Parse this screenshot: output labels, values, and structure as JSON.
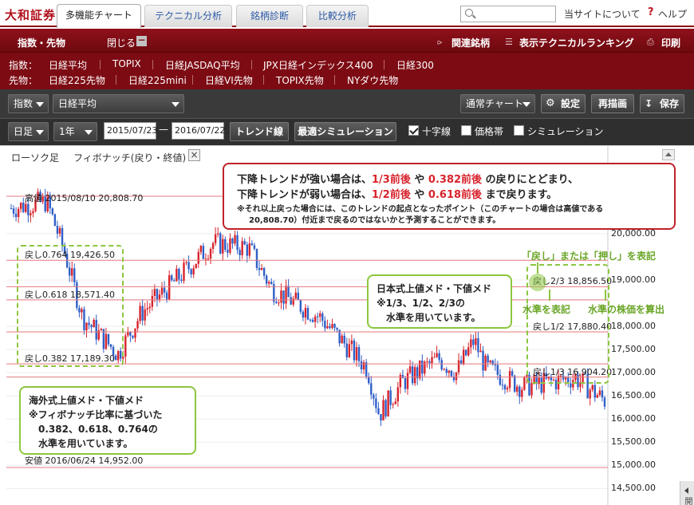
{
  "header": {
    "logo": "大和証券",
    "tabs": [
      {
        "label": "多機能チャート",
        "active": true
      },
      {
        "label": "テクニカル分析",
        "active": false
      },
      {
        "label": "銘柄診断",
        "active": false
      },
      {
        "label": "比較分析",
        "active": false
      }
    ],
    "search_placeholder": "",
    "about": "当サイトについて",
    "help_mark": "?",
    "help": "ヘルプ"
  },
  "panel": {
    "title": "指数・先物",
    "close": "閉じる",
    "close_mark": "−",
    "links": [
      "関連銘柄",
      "表示テクニカルランキング",
      "印刷"
    ],
    "row1_label": "指数：",
    "row1": [
      "日経平均",
      "TOPIX",
      "日経JASDAQ平均",
      "JPX日経インデックス400",
      "日経300"
    ],
    "row2_label": "先物：",
    "row2": [
      "日経225先物",
      "日経225mini",
      "日経VI先物",
      "TOPIX先物",
      "NYダウ先物"
    ]
  },
  "toolbar1": {
    "category": "指数",
    "symbol": "日経平均",
    "chart_type": "通常チャート",
    "settings": "設定",
    "redraw": "再描画",
    "save": "保存"
  },
  "toolbar2": {
    "period": "日足",
    "range": "1年",
    "date_from": "2015/07/23",
    "date_sep": "—",
    "date_to": "2016/07/22",
    "trendline": "トレンド線",
    "optimize": "最適シミュレーション",
    "crosshair": {
      "label": "十字線",
      "checked": true
    },
    "price_band": {
      "label": "価格帯",
      "checked": false
    },
    "simulation": {
      "label": "シミュレーション",
      "checked": false
    }
  },
  "chart": {
    "legend_candle": "ローソク足",
    "legend_fib": "フィボナッチ(戻り・終値)",
    "legend_close": "×",
    "side_tab": "開く",
    "high_label": "高値 2015/08/10 20,808.70",
    "low_label": "安値 2016/06/24 14,952.00",
    "fib_left": [
      {
        "label": "戻し0.764 19,426.50",
        "value": 19426.5
      },
      {
        "label": "戻し0.618 18,571.40",
        "value": 18571.4
      },
      {
        "label": "戻し0.382 17,189.30",
        "value": 17189.3
      }
    ],
    "fib_right": [
      {
        "label": "戻し2/3 18,856.50",
        "value": 18856.5
      },
      {
        "label": "戻し1/2 17,880.40",
        "value": 17880.4
      },
      {
        "label": "戻し1/3 16,904.20",
        "value": 16904.2
      }
    ],
    "y_ticks": [
      "20,000.00",
      "19,000.00",
      "18,000.00",
      "17,500.00",
      "17,000.00",
      "16,500.00",
      "16,000.00",
      "15,500.00",
      "15,000.00",
      "14,500.00"
    ],
    "colors": {
      "up": "#d8242d",
      "down": "#2f5fc8",
      "fib_line": "#e3787c",
      "callout_red": "#c0222b",
      "callout_green": "#8cc63f"
    }
  },
  "callouts": {
    "top_line1_a": "下降トレンドが強い場合は、",
    "top_line1_b": "1/3前後",
    "top_line1_c": " や ",
    "top_line1_d": "0.382前後",
    "top_line1_e": " の戻りにとどまり、",
    "top_line2_a": "下降トレンドが弱い場合は、",
    "top_line2_b": "1/2前後",
    "top_line2_c": " や ",
    "top_line2_d": "0.618前後",
    "top_line2_e": " まで戻ります。",
    "top_note1": "※それ以上戻った場合には、このトレンドの起点となったポイント（このチャートの場合は高値である",
    "top_note2": "20,808.70）付近まで戻るのではないかと予測することができます。",
    "japan_1": "日本式上値メド・下値メド",
    "japan_2": "※1/3、1/2、2/3の",
    "japan_3": "水準を用いています。",
    "foreign_1": "海外式上値メド・下値メド",
    "foreign_2": "※フィボナッチ比率に基づいた",
    "foreign_3": "0.382、0.618、0.764の",
    "foreign_4": "水準を用いています。",
    "green_top": "「戻し」または「押し」を表記",
    "green_left": "水準を表記",
    "green_right": "水準の株価を算出"
  }
}
